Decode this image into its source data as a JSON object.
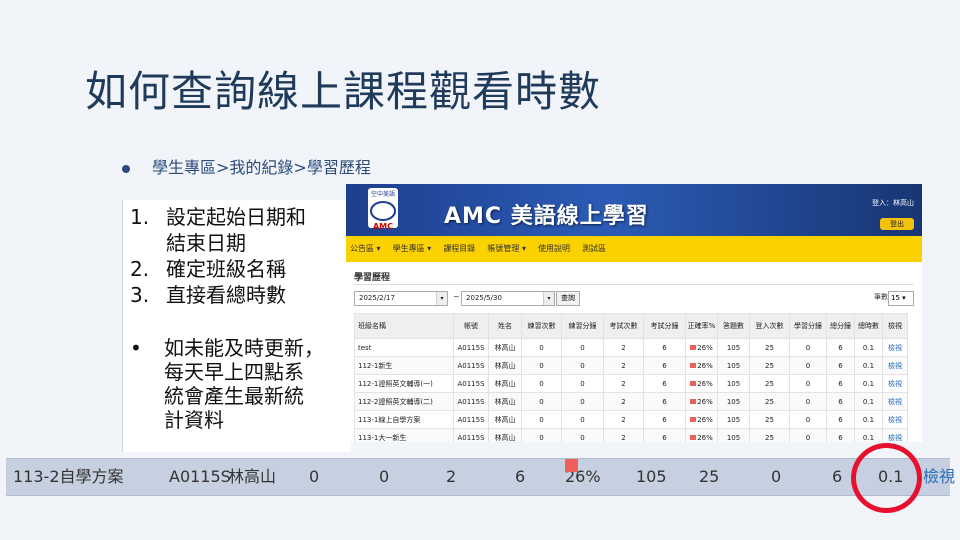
{
  "slide": {
    "title": "如何查詢線上課程觀看時數",
    "bullet": "學生專區>我的紀錄>學習歷程",
    "steps": [
      {
        "num": "1.",
        "line1": "設定起始日期和",
        "line2": "結束日期"
      },
      {
        "num": "2.",
        "line1": "確定班級名稱"
      },
      {
        "num": "3.",
        "line1": "直接看總時數"
      }
    ],
    "note": {
      "bullet": "•",
      "lines": [
        "如未能及時更新，",
        "每天早上四點系",
        "統會產生最新統",
        "計資料"
      ]
    }
  },
  "app": {
    "logo_text": "空中美語",
    "logo_abbr": "AMC",
    "brand": "AMC 美語線上學習",
    "user": "登入：林高山",
    "logout": "登出",
    "nav": [
      "公告區 ▾",
      "學生專區 ▾",
      "課程目錄",
      "帳號管理 ▾",
      "使用說明",
      "測試區"
    ],
    "page_title": "學習歷程",
    "date_start": "2025/2/17",
    "date_sep": "~",
    "date_end": "2025/5/30",
    "query_label": "查詢",
    "page_size_label": "筆數",
    "page_size_value": "15",
    "columns": [
      "班級名稱",
      "帳號",
      "姓名",
      "練習次數",
      "練習分鐘",
      "考試次數",
      "考試分鐘",
      "正確率%",
      "答題數",
      "登入次數",
      "學習分鐘",
      "總分鐘",
      "總時數",
      "檢視"
    ],
    "rows": [
      [
        "test",
        "A0115S",
        "林高山",
        "0",
        "0",
        "2",
        "6",
        "26%",
        "105",
        "25",
        "0",
        "6",
        "0.1",
        "檢視"
      ],
      [
        "112-1新生",
        "A0115S",
        "林高山",
        "0",
        "0",
        "2",
        "6",
        "26%",
        "105",
        "25",
        "0",
        "6",
        "0.1",
        "檢視"
      ],
      [
        "112-1證照英文輔導(一)",
        "A0115S",
        "林高山",
        "0",
        "0",
        "2",
        "6",
        "26%",
        "105",
        "25",
        "0",
        "6",
        "0.1",
        "檢視"
      ],
      [
        "112-2證照英文輔導(二)",
        "A0115S",
        "林高山",
        "0",
        "0",
        "2",
        "6",
        "26%",
        "105",
        "25",
        "0",
        "6",
        "0.1",
        "檢視"
      ],
      [
        "113-1線上自學方案",
        "A0115S",
        "林高山",
        "0",
        "0",
        "2",
        "6",
        "26%",
        "105",
        "25",
        "0",
        "6",
        "0.1",
        "檢視"
      ],
      [
        "113-1大一新生",
        "A0115S",
        "林高山",
        "0",
        "0",
        "2",
        "6",
        "26%",
        "105",
        "25",
        "0",
        "6",
        "0.1",
        "檢視"
      ]
    ],
    "accent_yellow": "#fbd100",
    "banner_blue": "#1d3f8e"
  },
  "highlight_row": [
    "113-2自學方案",
    "A0115S",
    "林高山",
    "0",
    "0",
    "2",
    "6",
    "26%",
    "105",
    "25",
    "0",
    "6",
    "0.1",
    "檢視"
  ],
  "highlight_color": "#e8112d"
}
